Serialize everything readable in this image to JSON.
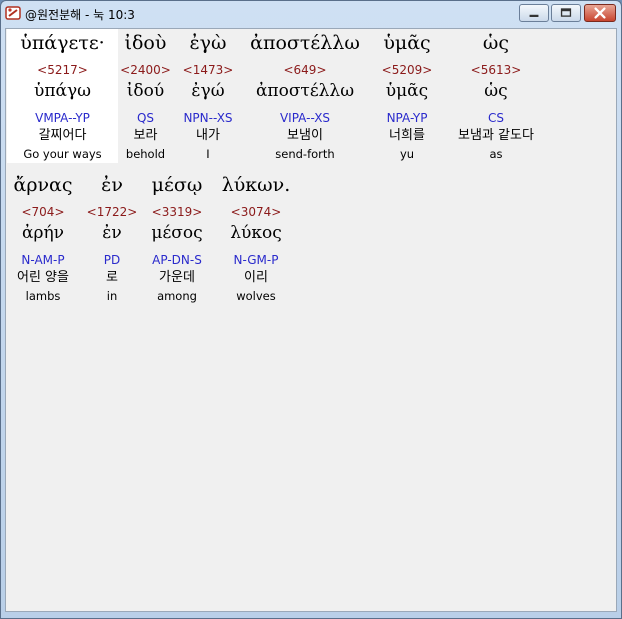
{
  "window": {
    "title": "@원전분해 - 눅 10:3"
  },
  "rows": [
    {
      "words": [
        {
          "greek": "ὑπάγετε·",
          "strongs": "<5217>",
          "lemma": "ὑπάγω",
          "parse": "VMPA--YP",
          "korean": "갈찌어다",
          "english": "Go your ways"
        },
        {
          "greek": "ἰδοὺ",
          "strongs": "<2400>",
          "lemma": "ἰδού",
          "parse": "QS",
          "korean": "보라",
          "english": "behold"
        },
        {
          "greek": "ἐγὼ",
          "strongs": "<1473>",
          "lemma": "ἐγώ",
          "parse": "NPN--XS",
          "korean": "내가",
          "english": "I"
        },
        {
          "greek": "ἀποστέλλω",
          "strongs": "<649>",
          "lemma": "ἀποστέλλω",
          "parse": "VIPA--XS",
          "korean": "보냄이",
          "english": "send-forth"
        },
        {
          "greek": "ὑμᾶς",
          "strongs": "<5209>",
          "lemma": "ὑμᾶς",
          "parse": "NPA-YP",
          "korean": "너희를",
          "english": "yu"
        },
        {
          "greek": "ὡς",
          "strongs": "<5613>",
          "lemma": "ὡς",
          "parse": "CS",
          "korean": "보냄과 같도다",
          "english": "as"
        }
      ]
    },
    {
      "words": [
        {
          "greek": "ἄρνας",
          "strongs": "<704>",
          "lemma": "ἀρήν",
          "parse": "N-AM-P",
          "korean": "어린 양을",
          "english": "lambs"
        },
        {
          "greek": "ἐν",
          "strongs": "<1722>",
          "lemma": "ἐν",
          "parse": "PD",
          "korean": "로",
          "english": "in"
        },
        {
          "greek": "μέσῳ",
          "strongs": "<3319>",
          "lemma": "μέσος",
          "parse": "AP-DN-S",
          "korean": "가운데",
          "english": "among"
        },
        {
          "greek": "λύκων.",
          "strongs": "<3074>",
          "lemma": "λύκος",
          "parse": "N-GM-P",
          "korean": "이리",
          "english": "wolves"
        }
      ]
    }
  ]
}
